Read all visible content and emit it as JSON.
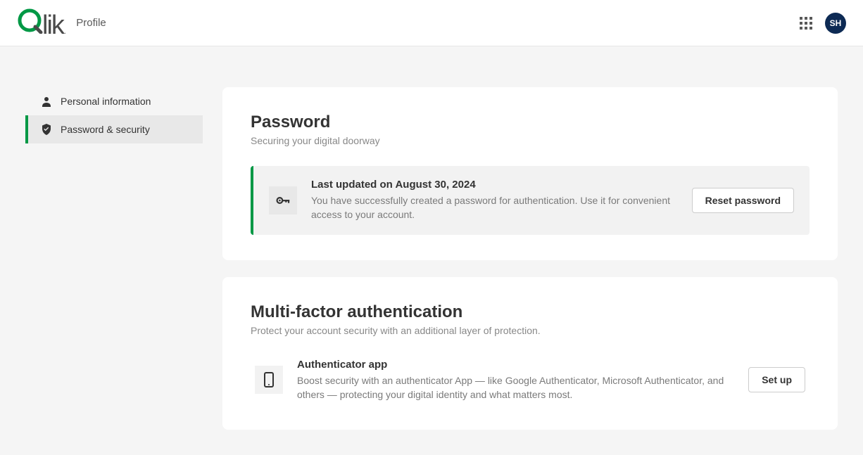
{
  "header": {
    "page_label": "Profile",
    "avatar_initials": "SH"
  },
  "sidebar": {
    "items": [
      {
        "label": "Personal information"
      },
      {
        "label": "Password & security"
      }
    ]
  },
  "password_section": {
    "title": "Password",
    "subtitle": "Securing your digital doorway",
    "info_title": "Last updated on August 30, 2024",
    "info_desc": "You have successfully created a password for authentication. Use it for convenient access to your account.",
    "reset_button": "Reset password"
  },
  "mfa_section": {
    "title": "Multi-factor authentication",
    "subtitle": "Protect your account security with an additional layer of protection.",
    "info_title": "Authenticator app",
    "info_desc": "Boost security with an authenticator App — like Google Authenticator, Microsoft Authenticator, and others — protecting your digital identity and what matters most.",
    "setup_button": "Set up"
  }
}
